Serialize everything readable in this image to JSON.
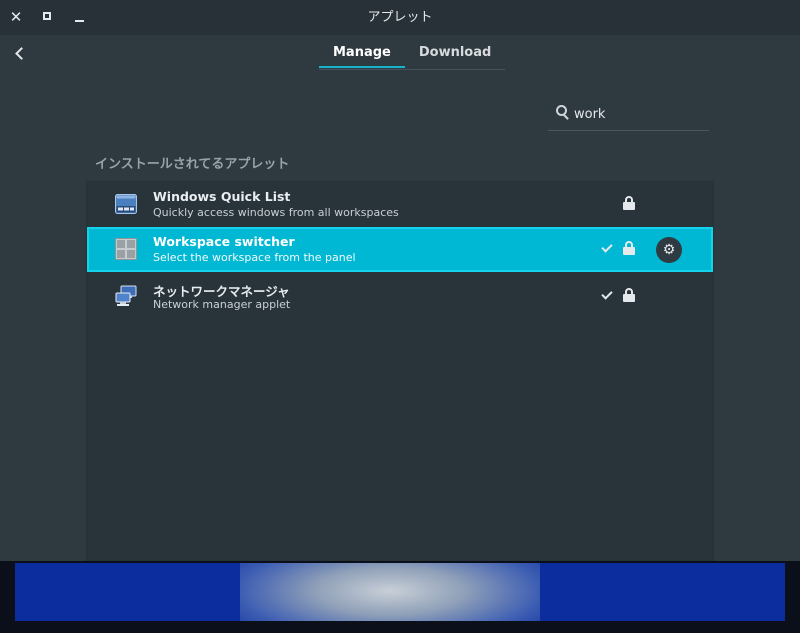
{
  "window": {
    "title": "アプレット",
    "close_symbol": "✕"
  },
  "tabs": [
    {
      "label": "Manage",
      "active": true
    },
    {
      "label": "Download",
      "active": false
    }
  ],
  "search": {
    "value": "work",
    "placeholder": ""
  },
  "section_title": "インストールされてるアプレット",
  "applets": [
    {
      "name": "Windows Quick List",
      "description": "Quickly access windows from all workspaces",
      "enabled": false,
      "locked": true,
      "selected": false,
      "icon": "window-list-icon"
    },
    {
      "name": "Workspace switcher",
      "description": "Select the workspace from the panel",
      "enabled": true,
      "locked": true,
      "selected": true,
      "icon": "workspace-grid-icon"
    },
    {
      "name": "ネットワークマネージャ",
      "description": "Network manager applet",
      "enabled": true,
      "locked": true,
      "selected": false,
      "icon": "network-computers-icon"
    }
  ],
  "config_symbol": "⚙",
  "colors": {
    "accent": "#00b8d4",
    "window_bg": "#2f3940",
    "titlebar_bg": "#283137"
  }
}
